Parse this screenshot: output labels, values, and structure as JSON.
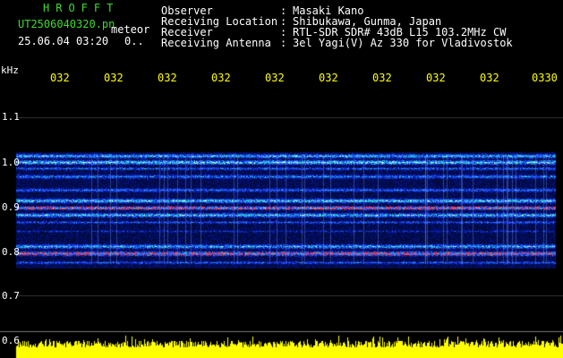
{
  "header": {
    "program": "HROFFT",
    "file_name": "UT2506040320.pn",
    "meteor_label": "meteor",
    "datetime": "25.06.04 03:20",
    "count": "0.."
  },
  "station_info": [
    {
      "label": "Observer",
      "value": "Masaki Kano"
    },
    {
      "label": "Receiving Location",
      "value": "Shibukawa, Gunma, Japan"
    },
    {
      "label": "Receiver",
      "value": "RTL-SDR SDR# 43dB L15 103.2MHz CW"
    },
    {
      "label": "Receiving Antenna",
      "value": "3el Yagi(V) Az 330 for Vladivostok"
    }
  ],
  "axis": {
    "unit": "kHz",
    "y_labels": [
      "1.1",
      "1.0",
      "0.9",
      "0.8",
      "0.7",
      "0.6"
    ],
    "time_ticks": [
      "032",
      "032",
      "032",
      "032",
      "032",
      "032",
      "032",
      "032",
      "032",
      "0330"
    ]
  },
  "colors": {
    "text_green": "#3ddc2a",
    "tick_yellow": "#ffff00",
    "background": "#000000"
  }
}
